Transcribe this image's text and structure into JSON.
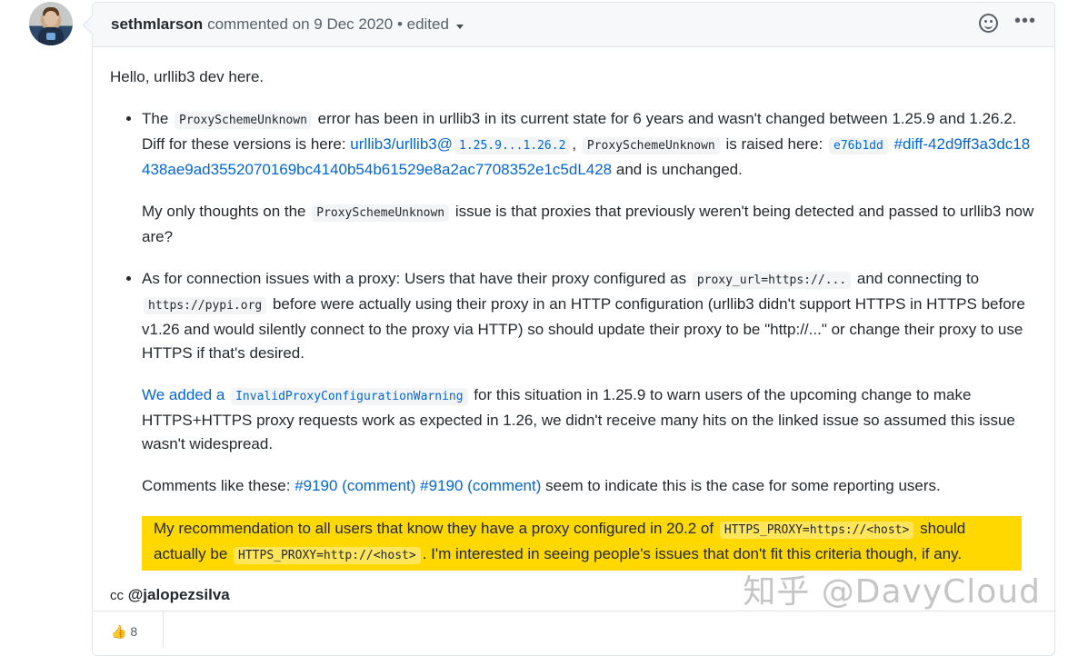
{
  "header": {
    "author": "sethmlarson",
    "meta": "commented on 9 Dec 2020 • edited",
    "emoji_icon": "smiley-icon",
    "more_icon": "kebab-horizontal-icon"
  },
  "body": {
    "intro": "Hello, urllib3 dev here.",
    "item1": {
      "t1": "The",
      "c1": "ProxySchemeUnknown",
      "t2": "error has been in urllib3 in its current state for 6 years and wasn't changed between 1.25.9 and 1.26.2. Diff for these versions is here:",
      "link1": "urllib3/urllib3@",
      "link1_code": "1.25.9...1.26.2",
      "t3": ",",
      "c2": "ProxySchemeUnknown",
      "t4": "is raised here:",
      "link2_code": "e76b1dd",
      "link2": "#diff-42d9ff3a3dc18438ae9ad3552070169bc4140b54b61529e8a2ac7708352e1c5dL428",
      "t5": "and is unchanged.",
      "p2_t1": "My only thoughts on the",
      "p2_c1": "ProxySchemeUnknown",
      "p2_t2": "issue is that proxies that previously weren't being detected and passed to urllib3 now are?"
    },
    "item2": {
      "t1": "As for connection issues with a proxy: Users that have their proxy configured as",
      "c1": "proxy_url=https://...",
      "t2": "and connecting to",
      "c2": "https://pypi.org",
      "t3": "before were actually using their proxy in an HTTP configuration (urllib3 didn't support HTTPS in HTTPS before v1.26 and would silently connect to the proxy via HTTP) so should update their proxy to be \"http://...\" or change their proxy to use HTTPS if that's desired.",
      "p2_link": "We added a",
      "p2_code": "InvalidProxyConfigurationWarning",
      "p2_t1": "for this situation in 1.25.9 to warn users of the upcoming change to make HTTPS+HTTPS proxy requests work as expected in 1.26, we didn't receive many hits on the linked issue so assumed this issue wasn't widespread.",
      "p3_t1": "Comments like these:",
      "p3_link1": "#9190 (comment)",
      "p3_link2": "#9190 (comment)",
      "p3_t2": "seem to indicate this is the case for some reporting users.",
      "p4_t1": "My recommendation to all users that know they have a proxy configured in 20.2 of",
      "p4_c1": "HTTPS_PROXY=https://<host>",
      "p4_t2": "should actually be",
      "p4_c2": "HTTPS_PROXY=http://<host>",
      "p4_t3": ". I'm interested in seeing people's issues that don't fit this criteria though, if any."
    },
    "cc": "cc",
    "mention": "@jalopezsilva"
  },
  "reactions": {
    "thumbs_up_count": "8"
  },
  "watermark": "知乎 @DavyCloud"
}
